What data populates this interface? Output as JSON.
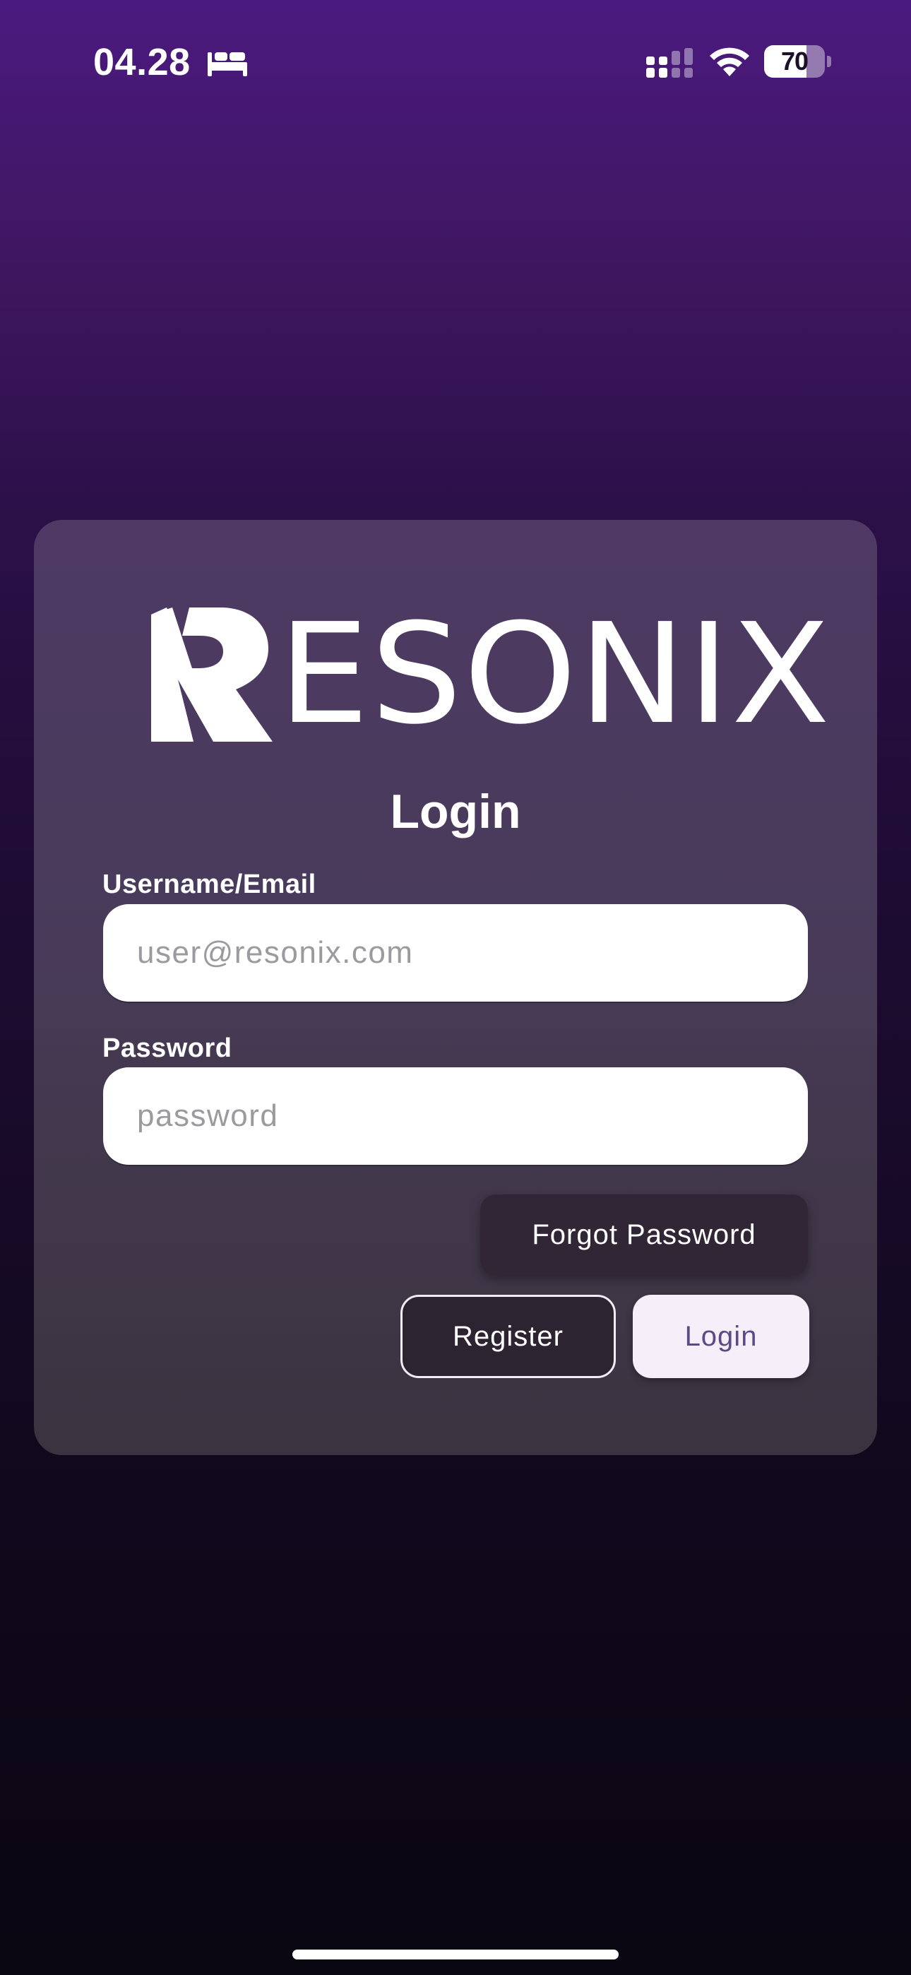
{
  "status_bar": {
    "time": "04.28",
    "sleep_focus_icon": "bed-icon",
    "signal_icon": "cellular-signal-icon",
    "wifi_icon": "wifi-icon",
    "battery_level": 70,
    "battery_label": "70"
  },
  "brand": {
    "logo_text": "ESONIX",
    "logo_lettering": "RESONIX",
    "logo_icon": "lightning-bolt-icon"
  },
  "login": {
    "title": "Login",
    "username_label": "Username/Email",
    "username_placeholder": "user@resonix.com",
    "username_value": "",
    "password_label": "Password",
    "password_placeholder": "password",
    "password_value": "",
    "forgot_label": "Forgot Password",
    "register_label": "Register",
    "login_label": "Login"
  },
  "colors": {
    "background_top": "#4b1a7f",
    "background_bottom": "#0a0612",
    "card": "#4a3b5c",
    "input_bg": "#ffffff",
    "login_button_bg": "#f6eef8",
    "login_button_text": "#5b4a86",
    "secondary_button_bg": "#2c2430"
  }
}
